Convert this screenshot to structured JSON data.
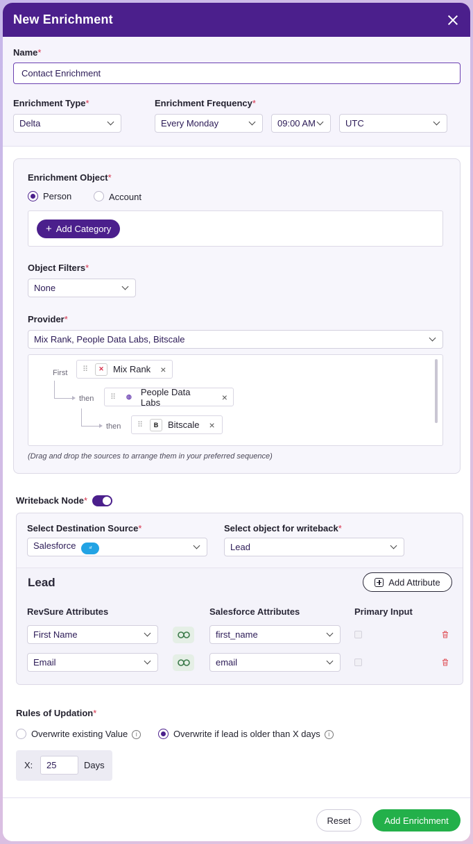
{
  "header": {
    "title": "New Enrichment"
  },
  "name": {
    "label": "Name",
    "value": "Contact Enrichment"
  },
  "enrichment_type": {
    "label": "Enrichment Type",
    "value": "Delta"
  },
  "enrichment_frequency": {
    "label": "Enrichment Frequency",
    "day": "Every Monday",
    "time": "09:00 AM",
    "timezone": "UTC"
  },
  "enrichment_object": {
    "label": "Enrichment Object",
    "options": [
      "Person",
      "Account"
    ],
    "selected": "Person",
    "add_category": "Add Category"
  },
  "object_filters": {
    "label": "Object Filters",
    "value": "None"
  },
  "provider": {
    "label": "Provider",
    "value": "Mix Rank, People Data Labs, Bitscale",
    "sequence": [
      {
        "prefix": "First",
        "name": "Mix Rank",
        "icon": "mixrank-icon"
      },
      {
        "prefix": "then",
        "name": "People Data Labs",
        "icon": "peopledatalabs-icon"
      },
      {
        "prefix": "then",
        "name": "Bitscale",
        "icon": "bitscale-icon"
      }
    ],
    "hint": "(Drag and drop the sources to arrange them in your preferred sequence)"
  },
  "writeback": {
    "label": "Writeback Node",
    "enabled": true,
    "destination_label": "Select Destination Source",
    "destination_value": "Salesforce",
    "object_label": "Select object for writeback",
    "object_value": "Lead",
    "section_title": "Lead",
    "add_attribute": "Add Attribute",
    "columns": [
      "RevSure Attributes",
      "Salesforce Attributes",
      "Primary Input"
    ],
    "rows": [
      {
        "revsure": "First Name",
        "salesforce": "first_name"
      },
      {
        "revsure": "Email",
        "salesforce": "email"
      }
    ]
  },
  "rules": {
    "label": "Rules of Updation",
    "option1": "Overwrite existing Value",
    "option2": "Overwrite if lead is older than X days",
    "selected": "option2",
    "x_label": "X:",
    "x_value": "25",
    "days_label": "Days"
  },
  "footer": {
    "reset": "Reset",
    "submit": "Add Enrichment"
  },
  "colors": {
    "primary": "#4b1f8c",
    "success": "#23b04a",
    "required": "#d6304a",
    "salesforce": "#22a3e4"
  }
}
